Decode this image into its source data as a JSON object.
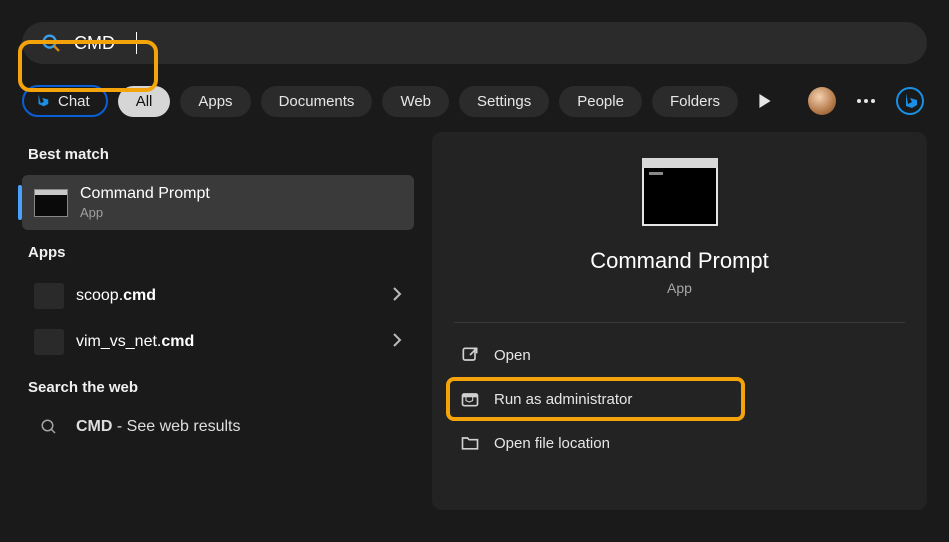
{
  "search": {
    "query": "CMD"
  },
  "pills": {
    "chat": "Chat",
    "all": "All",
    "apps": "Apps",
    "documents": "Documents",
    "web": "Web",
    "settings": "Settings",
    "people": "People",
    "folders": "Folders"
  },
  "sections": {
    "best_match": "Best match",
    "apps": "Apps",
    "search_web": "Search the web"
  },
  "results": {
    "best": {
      "name": "Command Prompt",
      "sub": "App"
    },
    "apps": [
      {
        "prefix": "scoop.",
        "bold": "cmd"
      },
      {
        "prefix": "vim_vs_net.",
        "bold": "cmd"
      }
    ],
    "web": {
      "bold": "CMD",
      "suffix": " - See web results"
    }
  },
  "detail": {
    "title": "Command Prompt",
    "sub": "App",
    "actions": {
      "open": "Open",
      "run_admin": "Run as administrator",
      "open_loc": "Open file location"
    }
  }
}
